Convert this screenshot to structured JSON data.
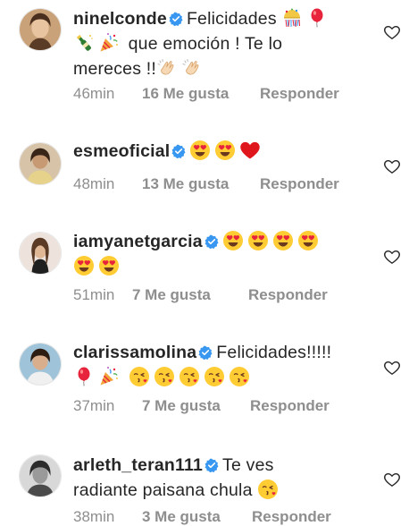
{
  "comments": [
    {
      "username": "ninelconde",
      "text_parts": [
        "Felicidades",
        "que emoción ! Te lo",
        "mereces !!"
      ],
      "time": "46min",
      "likes": "16 Me gusta",
      "reply": "Responder",
      "icons": [
        "verified-icon",
        "confetti-ball-emoji",
        "balloon-emoji",
        "champagne-emoji",
        "party-popper-emoji",
        "clapping-hands-emoji"
      ]
    },
    {
      "username": "esmeoficial",
      "text_parts": [],
      "time": "48min",
      "likes": "13 Me gusta",
      "reply": "Responder",
      "icons": [
        "verified-icon",
        "heart-eyes-emoji",
        "red-heart-emoji"
      ]
    },
    {
      "username": "iamyanetgarcia",
      "text_parts": [],
      "time": "51min",
      "likes": "7 Me gusta",
      "reply": "Responder",
      "icons": [
        "verified-icon",
        "heart-eyes-emoji"
      ]
    },
    {
      "username": "clarissamolina",
      "text_parts": [
        "Felicidades!!!!!"
      ],
      "time": "37min",
      "likes": "7 Me gusta",
      "reply": "Responder",
      "icons": [
        "verified-icon",
        "balloon-emoji",
        "party-popper-emoji",
        "kissing-heart-emoji"
      ]
    },
    {
      "username": "arleth_teran111",
      "text_parts": [
        "Te ves",
        "radiante paisana chula"
      ],
      "time": "38min",
      "likes": "3 Me gusta",
      "reply": "Responder",
      "icons": [
        "verified-icon",
        "kissing-heart-emoji"
      ]
    }
  ],
  "colors": {
    "verified_blue": "#3897f0",
    "meta_gray": "#8e8e8e",
    "text": "#262626",
    "heart_red": "#e0161d"
  }
}
